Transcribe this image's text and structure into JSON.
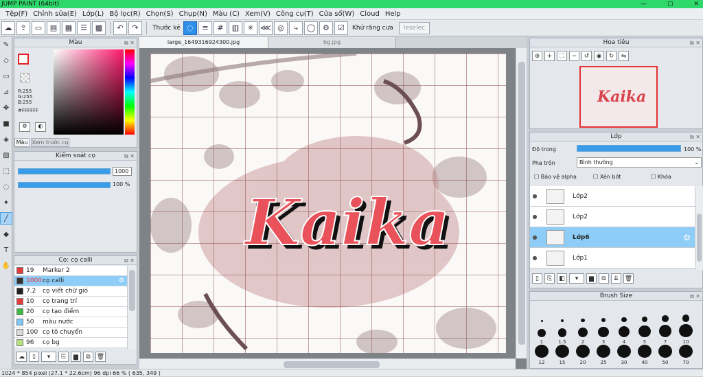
{
  "window": {
    "title": "JUMP PAINT (64bit)"
  },
  "menu": [
    "Tệp(F)",
    "Chỉnh sửa(E)",
    "Lớp(L)",
    "Bộ lọc(R)",
    "Chọn(S)",
    "Chụp(N)",
    "Màu (C)",
    "Xem(V)",
    "Công cụ(T)",
    "Cửa sổ(W)",
    "Cloud",
    "Help"
  ],
  "toolbar": {
    "ruler_label": "Thước kẻ",
    "antialias_label": "Khử răng cưa",
    "select_button": "leselec"
  },
  "color_panel": {
    "title": "Màu",
    "r": "R:255",
    "g": "G:255",
    "b": "B:255",
    "hex": "#FFFFFF",
    "tab_color": "Màu",
    "tab_preview": "Xem trước cọ"
  },
  "brush_control": {
    "title": "Kiểm soát cọ",
    "size_value": "1000",
    "opacity_value": "100 %",
    "size_fill": 100,
    "opacity_fill": 100
  },
  "brush_panel": {
    "title": "Cọ: cọ calli",
    "items": [
      {
        "size": "19",
        "name": "Marker 2",
        "color": "#e53b3b"
      },
      {
        "size": "1000",
        "name": "cọ calli",
        "color": "#333333",
        "selected": true
      },
      {
        "size": "7.2",
        "name": "cọ viết chữ gió",
        "color": "#222222"
      },
      {
        "size": "10",
        "name": "cọ trang trí",
        "color": "#e53b3b"
      },
      {
        "size": "20",
        "name": "cọ tạo điểm",
        "color": "#3fb93f"
      },
      {
        "size": "50",
        "name": "màu nước",
        "color": "#7ec6f3"
      },
      {
        "size": "100",
        "name": "cọ tô chuyển",
        "color": "#d9d9d9"
      },
      {
        "size": "96",
        "name": "cọ bg",
        "color": "#b6e27e"
      }
    ]
  },
  "tabs": [
    {
      "label": "large_1649316924300.jpg"
    },
    {
      "label": "bg.jpg"
    }
  ],
  "canvas": {
    "text": "Kaika"
  },
  "navigator": {
    "title": "Hoa tiêu",
    "preview_text": "Kaika"
  },
  "layer_panel": {
    "title": "Lớp",
    "opacity_label": "Độ trong",
    "opacity_value": "100 %",
    "opacity_fill": 100,
    "blend_label": "Pha trộn",
    "blend_value": "Bình thường",
    "protect_alpha": "Bảo vệ alpha",
    "clip": "Xén bớt",
    "lock": "Khóa",
    "layers": [
      {
        "name": "Lớp2"
      },
      {
        "name": "Lớp2"
      },
      {
        "name": "Lớp6",
        "selected": true
      },
      {
        "name": "Lớp1"
      }
    ]
  },
  "brush_size": {
    "title": "Brush Size",
    "sizes": [
      "",
      "",
      "",
      "",
      "",
      "",
      "",
      "",
      "1",
      "1.5",
      "2",
      "3",
      "4",
      "5",
      "7",
      "10",
      "12",
      "15",
      "20",
      "25",
      "30",
      "40",
      "50",
      "70"
    ]
  },
  "status": {
    "text": "1024 * 854 pixel   (27.1 * 22.6cm)   96 dpi   66 %   ( 635, 349 )"
  }
}
